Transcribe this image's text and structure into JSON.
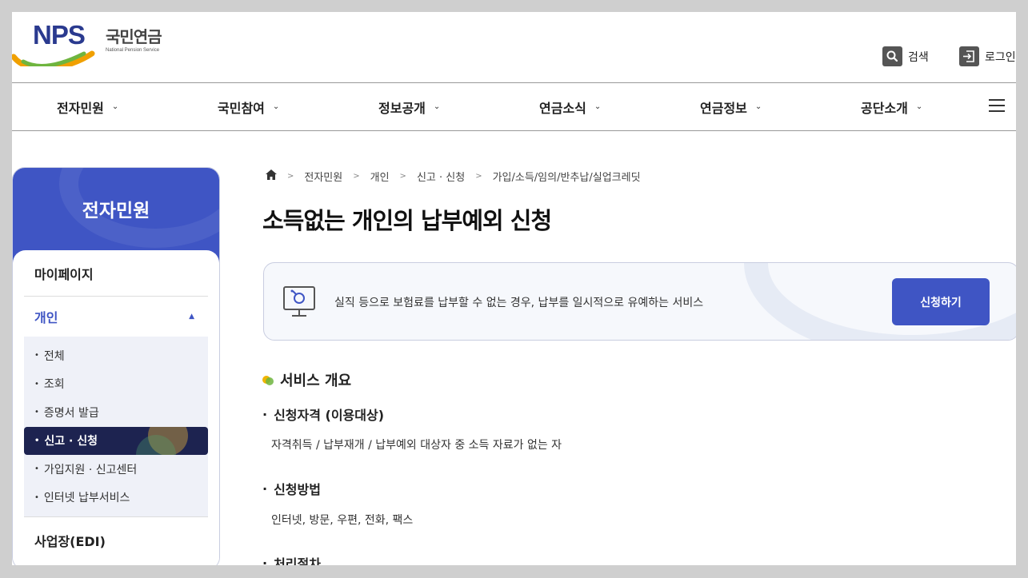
{
  "header": {
    "logo_ko": "국민연금",
    "logo_en": "National Pension Service",
    "logo_mark": "NPS",
    "search_label": "검색",
    "login_label": "로그인"
  },
  "gnb": {
    "items": [
      "전자민원",
      "국민참여",
      "정보공개",
      "연금소식",
      "연금정보",
      "공단소개"
    ]
  },
  "sidebar": {
    "title": "전자민원",
    "items": {
      "mypage": "마이페이지",
      "personal": "개인",
      "workplace": "사업장(EDI)"
    },
    "sub": [
      "전체",
      "조회",
      "증명서 발급",
      "신고 · 신청",
      "가입지원 · 신고센터",
      "인터넷 납부서비스"
    ]
  },
  "breadcrumb": [
    "전자민원",
    "개인",
    "신고 · 신청",
    "가입/소득/임의/반추납/실업크레딧"
  ],
  "page_title": "소득없는 개인의 납부예외 신청",
  "service": {
    "description": "실직 등으로 보험료를 납부할 수 없는 경우, 납부를 일시적으로 유예하는 서비스",
    "apply_label": "신청하기"
  },
  "overview": {
    "title": "서비스 개요",
    "eligibility_title": "신청자격 (이용대상)",
    "eligibility_text": "자격취득 / 납부재개 / 납부예외 대상자 중 소득 자료가 없는 자",
    "method_title": "신청방법",
    "method_text": "인터넷, 방문, 우편, 전화, 팩스",
    "process_title": "처리절차"
  },
  "colors": {
    "primary": "#3f55c4",
    "dark_navy": "#1d2350",
    "bullet_yellow": "#f0b400",
    "bullet_green": "#6fb53f"
  }
}
